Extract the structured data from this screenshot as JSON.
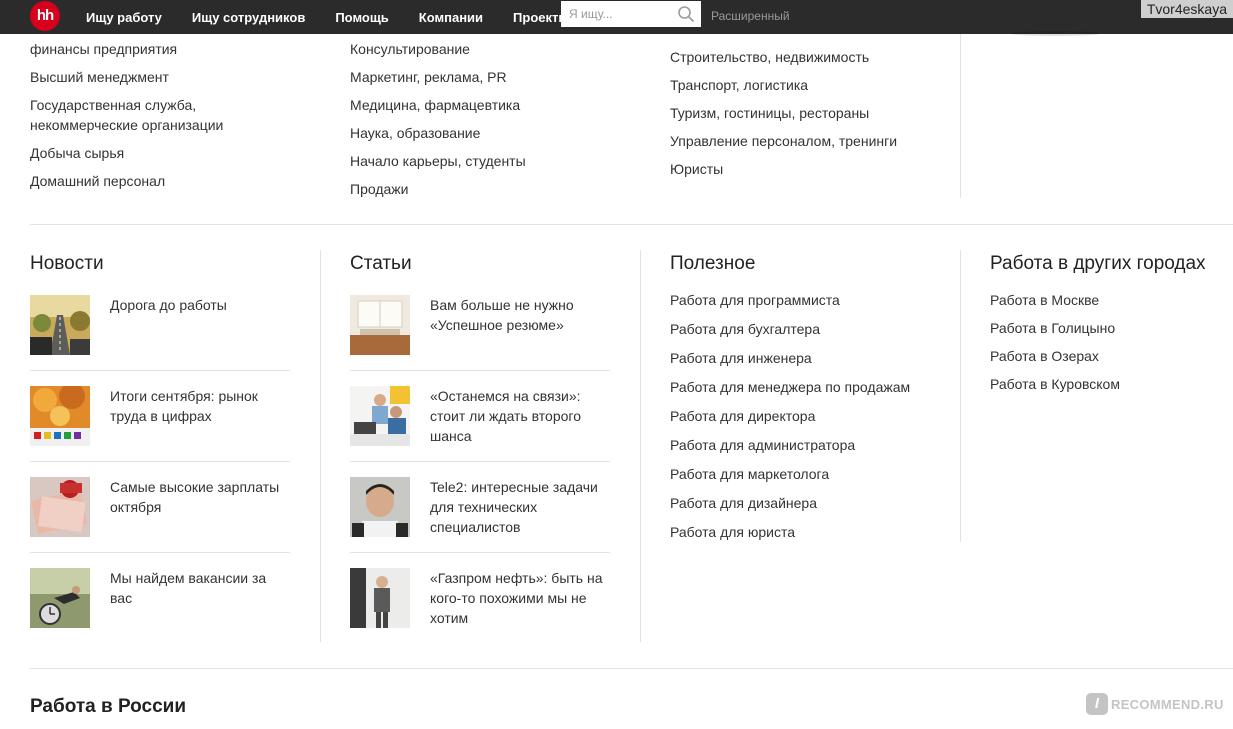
{
  "header": {
    "logo_text": "hh",
    "nav": [
      "Ищу работу",
      "Ищу сотрудников",
      "Помощь",
      "Компании",
      "Проекты"
    ],
    "search_placeholder": "Я ищу...",
    "advanced_label": "Расширенный",
    "username": "Tvor4eskaya"
  },
  "categories": {
    "col1": [
      "финансы предприятия",
      "Высший менеджмент",
      "Государственная служба, некоммерческие организации",
      "Добыча сырья",
      "Домашний персонал"
    ],
    "col2": [
      "Консультирование",
      "Маркетинг, реклама, PR",
      "Медицина, фармацевтика",
      "Наука, образование",
      "Начало карьеры, студенты",
      "Продажи"
    ],
    "col3": [
      "Строительство, недвижимость",
      "Транспорт, логистика",
      "Туризм, гостиницы, рестораны",
      "Управление персоналом, тренинги",
      "Юристы"
    ]
  },
  "news": {
    "title": "Новости",
    "items": [
      "Дорога до работы",
      "Итоги сентября: рынок труда в цифрах",
      "Самые высокие зарплаты октября",
      "Мы найдем вакансии за вас"
    ]
  },
  "articles": {
    "title": "Статьи",
    "items": [
      "Вам больше не нужно «Успешное резюме»",
      "«Останемся на связи»: стоит ли ждать второго шанса",
      "Tele2: интересные задачи для технических специалистов",
      "«Газпром нефть»: быть на кого-то похожими мы не хотим"
    ]
  },
  "useful": {
    "title": "Полезное",
    "items": [
      "Работа для программиста",
      "Работа для бухгалтера",
      "Работа для инженера",
      "Работа для менеджера по продажам",
      "Работа для директора",
      "Работа для администратора",
      "Работа для маркетолога",
      "Работа для дизайнера",
      "Работа для юриста"
    ]
  },
  "cities": {
    "title": "Работа в других городах",
    "items": [
      "Работа в Москве",
      "Работа в Голицыно",
      "Работа в Озерах",
      "Работа в Куровском"
    ]
  },
  "russia_title": "Работа в России",
  "watermark": {
    "badge": "I",
    "text": "RECOMMEND.RU"
  },
  "colors": {
    "topbar": "#2b2b2b",
    "logo": "#d6001c",
    "divider": "#e2e2e2",
    "text": "#333333"
  }
}
